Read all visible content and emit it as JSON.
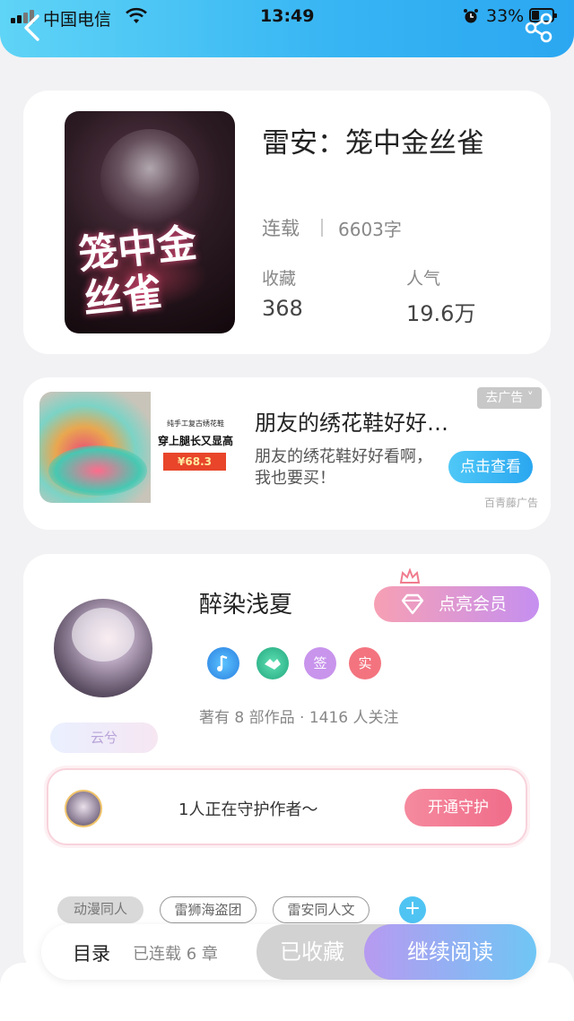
{
  "status_bar": {
    "carrier": "中国电信",
    "time": "13:49",
    "battery": "33%"
  },
  "book": {
    "title": "雷安：笼中金丝雀",
    "cover_title": "笼中金丝雀",
    "status": "连载",
    "word_count": "6603字",
    "favorites_label": "收藏",
    "favorites_value": "368",
    "popularity_label": "人气",
    "popularity_value": "19.6万"
  },
  "ad": {
    "image_line1": "纯手工复古绣花鞋",
    "image_line2": "穿上腿长又显高",
    "image_price": "¥68.3",
    "title": "朋友的绣花鞋好好…",
    "description": "朋友的绣花鞋好好看啊，我也要买！",
    "remove_label": "去广告 ˅",
    "cta_label": "点击查看",
    "source": "百青藤广告"
  },
  "author": {
    "name": "醉染浅夏",
    "tag": "云兮",
    "vip_label": "点亮会员",
    "badges": [
      {
        "label": "",
        "color": "#3aa0f0"
      },
      {
        "label": "",
        "color": "#3ac79a"
      },
      {
        "label": "签",
        "color": "#c894ec"
      },
      {
        "label": "实",
        "color": "#f3747f"
      }
    ],
    "works_info": "著有 8 部作品 · 1416 人关注"
  },
  "guard": {
    "text": "1人正在守护作者～",
    "button": "开通守护"
  },
  "tags": [
    "动漫同人",
    "雷狮海盗团",
    "雷安同人文"
  ],
  "bottom": {
    "toc_label": "目录",
    "serial_info": "已连载 6 章",
    "collected_label": "已收藏",
    "continue_label": "继续阅读"
  },
  "colors": {
    "accent_blue": "#36b4f3",
    "vip_gradient_start": "#f7a0b4",
    "vip_gradient_end": "#c58ff0"
  }
}
